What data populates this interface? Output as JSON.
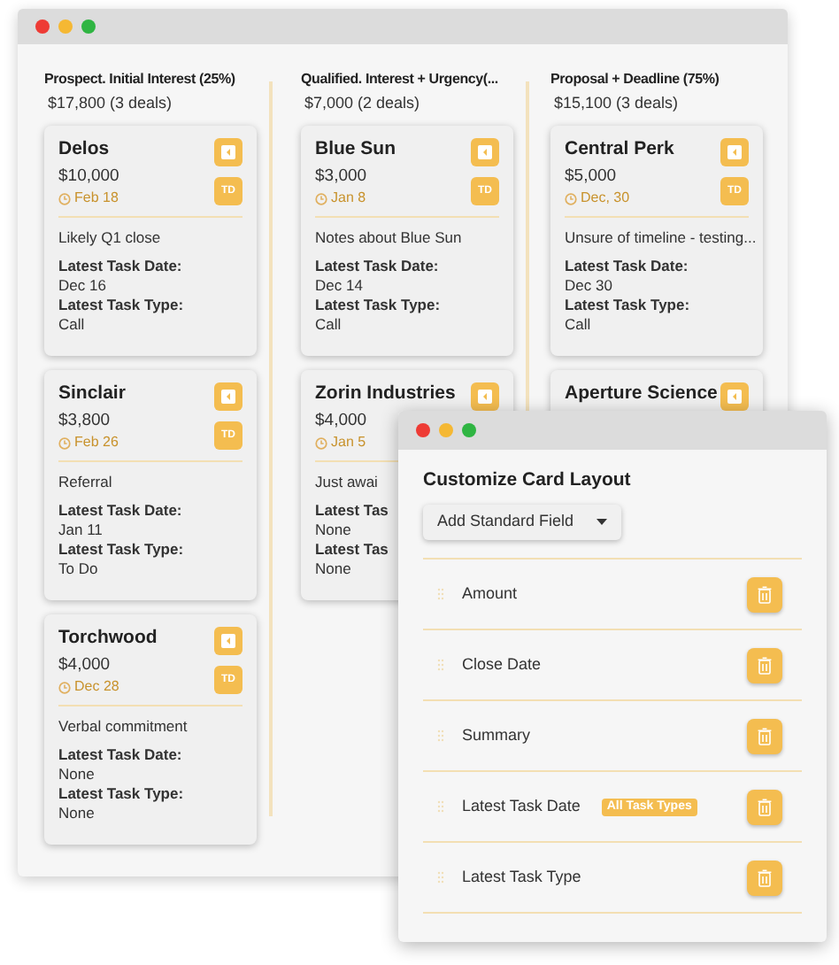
{
  "columns": [
    {
      "title": "Prospect. Initial Interest (25%)",
      "total": "$17,800 (3 deals)",
      "cards": [
        {
          "name": "Delos",
          "amount": "$10,000",
          "initials": "TD",
          "date": "Feb 18",
          "note": "Likely Q1 close",
          "fields": [
            {
              "label": "Latest Task Date:",
              "value": "Dec 16"
            },
            {
              "label": "Latest Task Type:",
              "value": "Call"
            }
          ]
        },
        {
          "name": "Sinclair",
          "amount": "$3,800",
          "initials": "TD",
          "date": "Feb 26",
          "note": "Referral",
          "fields": [
            {
              "label": "Latest Task Date:",
              "value": "Jan 11"
            },
            {
              "label": "Latest Task Type:",
              "value": "To Do"
            }
          ]
        },
        {
          "name": "Torchwood",
          "amount": "$4,000",
          "initials": "TD",
          "date": "Dec 28",
          "note": "Verbal commitment",
          "fields": [
            {
              "label": "Latest Task Date:",
              "value": "None"
            },
            {
              "label": "Latest Task Type:",
              "value": "None"
            }
          ]
        }
      ]
    },
    {
      "title": "Qualified. Interest + Urgency(...",
      "total": "$7,000 (2 deals)",
      "cards": [
        {
          "name": "Blue Sun",
          "amount": "$3,000",
          "initials": "TD",
          "date": "Jan 8",
          "note": "Notes about Blue Sun",
          "fields": [
            {
              "label": "Latest Task Date:",
              "value": "Dec 14"
            },
            {
              "label": "Latest Task Type:",
              "value": "Call"
            }
          ]
        },
        {
          "name": "Zorin Industries",
          "amount": "$4,000",
          "date": "Jan 5",
          "note": "Just awai",
          "fields": [
            {
              "label": "Latest Tas",
              "value": "None"
            },
            {
              "label": "Latest Tas",
              "value": "None"
            }
          ]
        }
      ]
    },
    {
      "title": "Proposal + Deadline (75%)",
      "total": "$15,100 (3 deals)",
      "cards": [
        {
          "name": "Central Perk",
          "amount": "$5,000",
          "initials": "TD",
          "date": "Dec, 30",
          "note": "Unsure of timeline - testing...",
          "fields": [
            {
              "label": "Latest Task Date:",
              "value": "Dec 30"
            },
            {
              "label": "Latest Task Type:",
              "value": "Call"
            }
          ]
        },
        {
          "name": "Aperture Science"
        }
      ]
    }
  ],
  "dialog": {
    "heading": "Customize Card Layout",
    "dropdown": "Add Standard Field",
    "fields": [
      {
        "label": "Amount"
      },
      {
        "label": "Close Date"
      },
      {
        "label": "Summary"
      },
      {
        "label": "Latest Task Date",
        "tag": "All Task Types"
      },
      {
        "label": "Latest Task Type"
      }
    ]
  }
}
